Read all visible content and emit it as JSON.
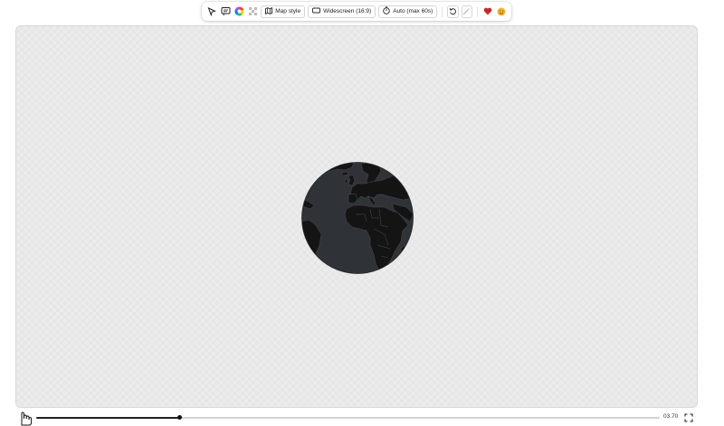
{
  "toolbar": {
    "tools": [
      {
        "name": "select-tool",
        "icon": "cursor-arrow-icon"
      },
      {
        "name": "comment-tool",
        "icon": "comment-icon"
      },
      {
        "name": "color-tool",
        "icon": "color-wheel-icon"
      },
      {
        "name": "pattern-tool",
        "icon": "pattern-icon"
      }
    ],
    "map_style_label": "Map style",
    "aspect_label": "Widescreen (16:9)",
    "duration_label": "Auto (max 60s)"
  },
  "canvas": {
    "globe_colors": {
      "ocean": "#2f3338",
      "land": "#141414",
      "borders": "#4a4f55"
    }
  },
  "timeline": {
    "time": "03.70",
    "progress": 0.23
  },
  "colors": {
    "accent": "#111111",
    "track": "#d2d2d2",
    "heart": "#c62828"
  }
}
